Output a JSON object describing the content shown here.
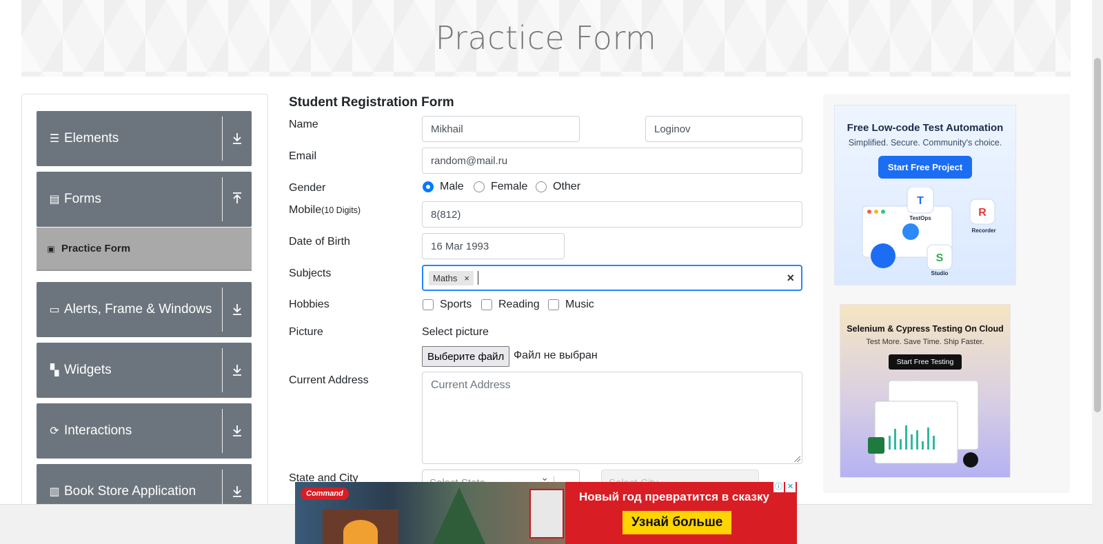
{
  "page": {
    "title": "Practice Form"
  },
  "sidebar": {
    "groups": [
      {
        "label": "Elements",
        "icon": "list-icon",
        "expanded": false
      },
      {
        "label": "Forms",
        "icon": "document-icon",
        "expanded": true
      },
      {
        "label": "Alerts, Frame & Windows",
        "icon": "window-icon",
        "expanded": false
      },
      {
        "label": "Widgets",
        "icon": "widgets-icon",
        "expanded": false
      },
      {
        "label": "Interactions",
        "icon": "interactions-icon",
        "expanded": false
      },
      {
        "label": "Book Store Application",
        "icon": "books-icon",
        "expanded": false
      }
    ],
    "active_item": {
      "label": "Practice Form",
      "icon": "form-icon"
    }
  },
  "form": {
    "title": "Student Registration Form",
    "labels": {
      "name": "Name",
      "email": "Email",
      "gender": "Gender",
      "mobile": "Mobile",
      "mobile_hint": "(10 Digits)",
      "dob": "Date of Birth",
      "subjects": "Subjects",
      "hobbies": "Hobbies",
      "picture": "Picture",
      "current_address": "Current Address",
      "state_city": "State and City"
    },
    "first_name": "Mikhail",
    "last_name": "Loginov",
    "email": "random@mail.ru",
    "gender_options": [
      "Male",
      "Female",
      "Other"
    ],
    "gender_selected": "Male",
    "mobile": "8(812)",
    "dob": "16 Mar 1993",
    "subjects": [
      "Maths"
    ],
    "subject_remove": "×",
    "subjects_clear": "×",
    "hobbies": [
      "Sports",
      "Reading",
      "Music"
    ],
    "picture_label": "Select picture",
    "file_button": "Выберите файл",
    "file_status": "Файл не выбран",
    "address_placeholder": "Current Address",
    "state_placeholder": "Select State",
    "city_placeholder": "Select City"
  },
  "ads": {
    "ad1": {
      "title": "Free Low-code Test Automation",
      "subtitle": "Simplified. Secure. Community's choice.",
      "button": "Start Free Project",
      "labels": [
        "TestOps",
        "Recorder",
        "Studio"
      ]
    },
    "ad2": {
      "title": "Selenium & Cypress Testing On Cloud",
      "subtitle": "Test More. Save Time. Ship Faster.",
      "button": "Start Free Testing"
    },
    "banner": {
      "brand": "Command",
      "headline": "Новый год превратится в сказку",
      "cta": "Узнай больше"
    }
  },
  "colors": {
    "accent": "#007bff",
    "sidebar_group": "#6c757d",
    "active_item": "#a9a9a9",
    "focus": "#2684ff",
    "banner": "#d91d24",
    "banner_cta": "#ffd400"
  }
}
